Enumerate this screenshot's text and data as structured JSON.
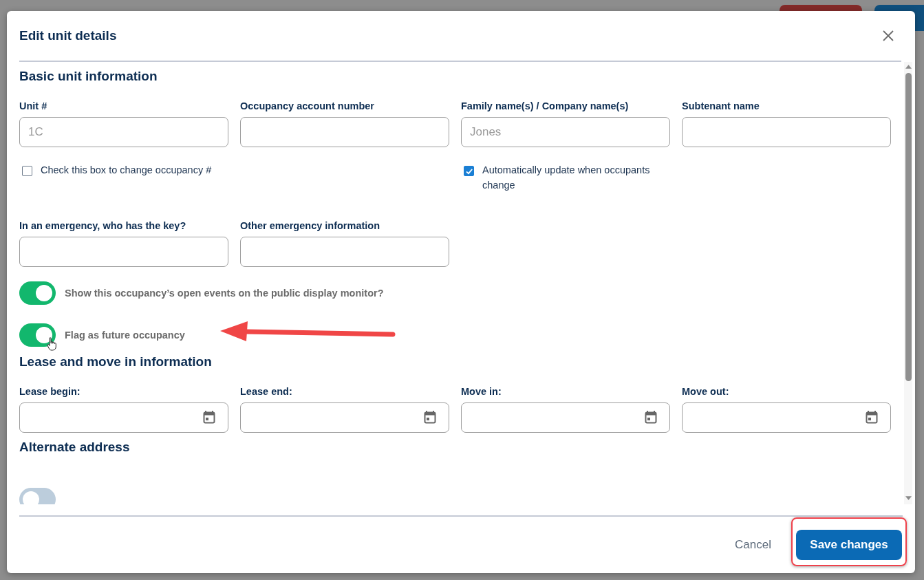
{
  "dialog": {
    "title": "Edit unit details"
  },
  "sections": [
    {
      "heading": "Basic unit information",
      "rows": [
        {
          "kind": "fields",
          "fields": [
            {
              "kind": "text",
              "label": "Unit #",
              "placeholder": "1C",
              "checkbox": {
                "label": "Check this box to change occupancy #",
                "checked": false
              }
            },
            {
              "kind": "text",
              "label": "Occupancy account number"
            },
            {
              "kind": "text",
              "label": "Family name(s) / Company name(s)",
              "placeholder": "Jones",
              "checkbox": {
                "label": "Automatically update when occupants change",
                "checked": true
              }
            },
            {
              "kind": "text",
              "label": "Subtenant name"
            }
          ]
        },
        {
          "kind": "fields",
          "fields": [
            {
              "kind": "text",
              "label": "In an emergency, who has the key?"
            },
            {
              "kind": "text",
              "label": "Other emergency information"
            }
          ]
        },
        {
          "kind": "toggle",
          "label": "Show this occupancy’s open events on the public display monitor?",
          "on": true
        },
        {
          "kind": "toggle",
          "label": "Flag as future occupancy",
          "on": true
        }
      ]
    },
    {
      "heading": "Lease and move in information",
      "rows": [
        {
          "kind": "fields",
          "fields": [
            {
              "kind": "date",
              "label": "Lease begin:"
            },
            {
              "kind": "date",
              "label": "Lease end:"
            },
            {
              "kind": "date",
              "label": "Move in:"
            },
            {
              "kind": "date",
              "label": "Move out:"
            }
          ]
        }
      ]
    },
    {
      "heading": "Alternate address",
      "rows": [
        {
          "kind": "toggle",
          "on": false
        }
      ]
    }
  ],
  "footer": {
    "buttons": [
      {
        "kind": "text",
        "label": "Cancel"
      },
      {
        "kind": "primary",
        "label": "Save changes"
      }
    ]
  }
}
